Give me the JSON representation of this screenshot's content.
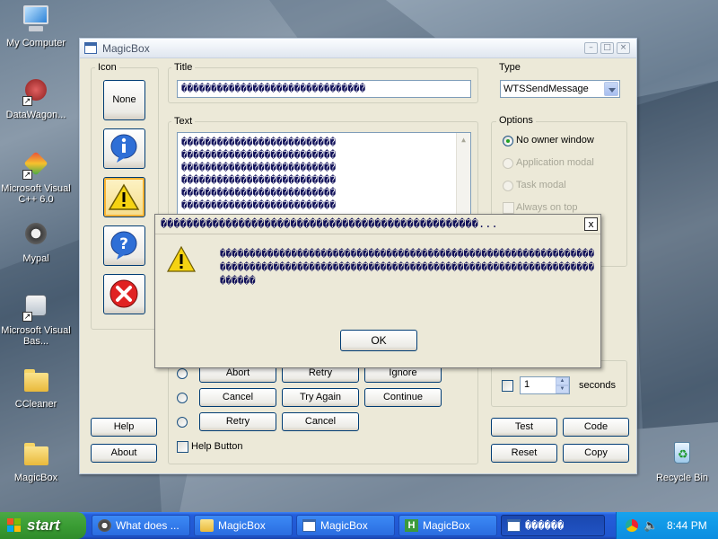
{
  "desktop": {
    "icons": [
      {
        "label": "My Computer"
      },
      {
        "label": "DataWagon..."
      },
      {
        "label": "Microsoft Visual C++ 6.0"
      },
      {
        "label": "Mypal"
      },
      {
        "label": "Microsoft Visual Bas..."
      },
      {
        "label": "CCleaner"
      },
      {
        "label": "MagicBox"
      },
      {
        "label": "Recycle Bin"
      }
    ]
  },
  "window": {
    "title": "MagicBox",
    "icon_group": {
      "label": "Icon",
      "none_label": "None",
      "icons": [
        "info-icon",
        "warning-icon",
        "question-icon",
        "error-icon"
      ],
      "selected": "warning-icon"
    },
    "title_group": {
      "label": "Title",
      "value": "�������������������������������"
    },
    "text_group": {
      "label": "Text",
      "lines": [
        "��������������������������",
        "��������������������������",
        "��������������������������",
        "��������������������������",
        "��������������������������",
        "��������������������������"
      ]
    },
    "type_group": {
      "label": "Type",
      "selected": "WTSSendMessage"
    },
    "options_group": {
      "label": "Options",
      "radios": [
        {
          "label": "No owner window",
          "checked": true,
          "enabled": true
        },
        {
          "label": "Application modal",
          "checked": false,
          "enabled": false
        },
        {
          "label": "Task modal",
          "checked": false,
          "enabled": false
        }
      ],
      "checkboxes": [
        {
          "label": "Always on top",
          "checked": false,
          "enabled": false
        }
      ]
    },
    "buttons_group": {
      "rows": [
        [
          "Abort",
          "Retry",
          "Ignore"
        ],
        [
          "Cancel",
          "Try Again",
          "Continue"
        ],
        [
          "Retry",
          "Cancel"
        ]
      ],
      "help_button_label": "Help Button"
    },
    "timeout": {
      "value": "1",
      "unit_label": "seconds"
    },
    "action_buttons": {
      "help": "Help",
      "about": "About",
      "test": "Test",
      "code": "Code",
      "reset": "Reset",
      "copy": "Copy"
    }
  },
  "message_box": {
    "title": "�������������������������������������������������...",
    "close_label": "x",
    "text": "������������������������������������������������������������������������������������������������������������������������������������",
    "ok_label": "OK"
  },
  "taskbar": {
    "start_label": "start",
    "tasks": [
      {
        "label": "What does ..."
      },
      {
        "label": "MagicBox"
      },
      {
        "label": "MagicBox"
      },
      {
        "label": "MagicBox"
      },
      {
        "label": "������"
      }
    ],
    "clock": "8:44 PM"
  },
  "colors": {
    "taskbar_blue": "#245edb",
    "start_green": "#3a9d34",
    "window_face": "#ece9d8",
    "button_border": "#003c74",
    "message_text": "#11115a"
  }
}
